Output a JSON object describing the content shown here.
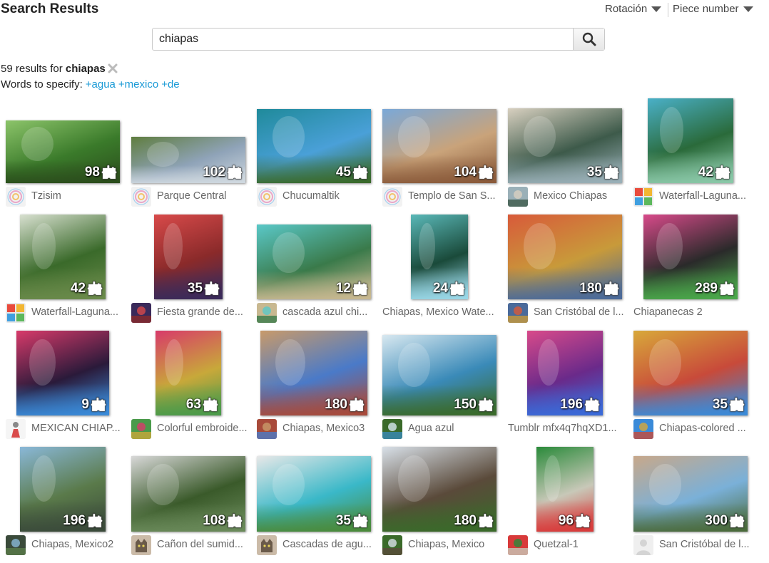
{
  "header": {
    "title": "Search Results",
    "rotation_label": "Rotación",
    "piece_label": "Piece number"
  },
  "search": {
    "query": "chiapas",
    "placeholder": ""
  },
  "summary": {
    "prefix": "59 results for",
    "query": "chiapas",
    "words_label": "Words to specify:",
    "words": [
      "+agua",
      "+mexico",
      "+de"
    ]
  },
  "icons": {
    "search": "search-icon",
    "clear": "close-icon",
    "pieces": "puzzle-piece-icon",
    "dropdown": "caret-down-icon"
  },
  "colors": {
    "link": "#1a9ad6",
    "title_text": "#666666",
    "count_text": "#ffffff"
  },
  "results": [
    {
      "title": "Tzisim",
      "pieces": "98",
      "avatar": "flower",
      "palette": [
        "#3a7a2a",
        "#8cc46a",
        "#2b4d1c"
      ]
    },
    {
      "title": "Parque Central",
      "pieces": "102",
      "avatar": "flower",
      "palette": [
        "#8fa3b8",
        "#5f7d3f",
        "#cfd8df"
      ]
    },
    {
      "title": "Chucumaltik",
      "pieces": "45",
      "avatar": "flower",
      "palette": [
        "#4aa0d8",
        "#1f8a9a",
        "#3a6a2a"
      ]
    },
    {
      "title": "Templo de San S...",
      "pieces": "104",
      "avatar": "flower",
      "palette": [
        "#c9a37a",
        "#7aa8d8",
        "#8a5a3a"
      ]
    },
    {
      "title": "Mexico Chiapas",
      "pieces": "35",
      "avatar": "photo",
      "palette": [
        "#3d5a4a",
        "#d8d0c0",
        "#9ab0b8"
      ]
    },
    {
      "title": "Waterfall-Laguna...",
      "pieces": "42",
      "avatar": "puzzle",
      "palette": [
        "#2a6a3a",
        "#4ab0c8",
        "#8ac8a8"
      ]
    },
    {
      "title": "Waterfall-Laguna...",
      "pieces": "42",
      "avatar": "puzzle",
      "palette": [
        "#3a6a2a",
        "#d8e0d0",
        "#6a8a4a"
      ]
    },
    {
      "title": "Fiesta grande de...",
      "pieces": "35",
      "avatar": "photo",
      "palette": [
        "#8a2a2a",
        "#d84a4a",
        "#3a2a5a"
      ]
    },
    {
      "title": "cascada azul chi...",
      "pieces": "12",
      "avatar": "photo",
      "palette": [
        "#3a7a4a",
        "#5ac8c8",
        "#c8b890"
      ]
    },
    {
      "title": "Chiapas, Mexico Wate...",
      "pieces": "24",
      "avatar": "none",
      "palette": [
        "#1a4a3a",
        "#5ab8b8",
        "#9ad8e8"
      ]
    },
    {
      "title": "San Cristóbal de l...",
      "pieces": "180",
      "avatar": "photo",
      "palette": [
        "#c89a3a",
        "#d85a3a",
        "#4a6a9a"
      ]
    },
    {
      "title": "Chiapanecas 2",
      "pieces": "289",
      "avatar": "none",
      "palette": [
        "#2a2a2a",
        "#d84a8a",
        "#4aa84a"
      ]
    },
    {
      "title": "MEXICAN CHIAP...",
      "pieces": "9",
      "avatar": "figure",
      "palette": [
        "#2a1a3a",
        "#d83a6a",
        "#3a8ad8"
      ]
    },
    {
      "title": "Colorful embroide...",
      "pieces": "63",
      "avatar": "photo",
      "palette": [
        "#c8a83a",
        "#d83a6a",
        "#4a9a4a"
      ]
    },
    {
      "title": "Chiapas, Mexico3",
      "pieces": "180",
      "avatar": "photo",
      "palette": [
        "#4a7ac8",
        "#c89a6a",
        "#a84a3a"
      ]
    },
    {
      "title": "Agua azul",
      "pieces": "150",
      "avatar": "photo",
      "palette": [
        "#3a8ab8",
        "#d8e8f0",
        "#3a6a2a"
      ]
    },
    {
      "title": "Tumblr mfx4q7hqXD1...",
      "pieces": "196",
      "avatar": "none",
      "palette": [
        "#6a2a8a",
        "#d84a8a",
        "#3a6ad8"
      ]
    },
    {
      "title": "Chiapas-colored ...",
      "pieces": "35",
      "avatar": "photo",
      "palette": [
        "#c84a3a",
        "#d8a83a",
        "#3a8ad8"
      ]
    },
    {
      "title": "Chiapas, Mexico2",
      "pieces": "196",
      "avatar": "photo",
      "palette": [
        "#5a7a4a",
        "#8ab8d8",
        "#3a4a3a"
      ]
    },
    {
      "title": "Cañon del sumid...",
      "pieces": "108",
      "avatar": "cat",
      "palette": [
        "#3a5a2a",
        "#d8d8d8",
        "#6a8a5a"
      ]
    },
    {
      "title": "Cascadas de agu...",
      "pieces": "35",
      "avatar": "cat",
      "palette": [
        "#3ab8c8",
        "#e8e8e8",
        "#4a8a3a"
      ]
    },
    {
      "title": "Chiapas, Mexico",
      "pieces": "180",
      "avatar": "photo",
      "palette": [
        "#5a4a3a",
        "#d8e0e8",
        "#3a6a2a"
      ]
    },
    {
      "title": "Quetzal-1",
      "pieces": "96",
      "avatar": "photo",
      "palette": [
        "#c8c8b8",
        "#2a8a3a",
        "#d83a3a"
      ]
    },
    {
      "title": "San Cristóbal de l...",
      "pieces": "300",
      "avatar": "blank",
      "palette": [
        "#7ab0d8",
        "#c8a88a",
        "#4a6a3a"
      ]
    }
  ]
}
